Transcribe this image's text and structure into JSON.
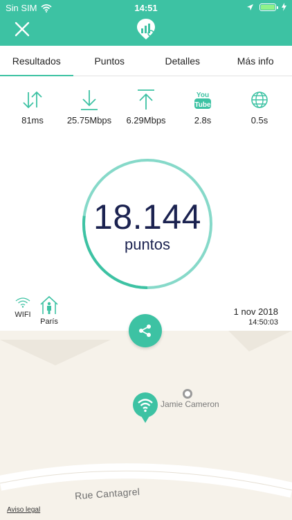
{
  "status_bar": {
    "carrier": "Sin SIM",
    "time": "14:51"
  },
  "tabs": [
    {
      "label": "Resultados"
    },
    {
      "label": "Puntos"
    },
    {
      "label": "Detalles"
    },
    {
      "label": "Más info"
    }
  ],
  "metrics": [
    {
      "icon": "ping-arrows-icon",
      "value": "81ms"
    },
    {
      "icon": "download-icon",
      "value": "25.75Mbps"
    },
    {
      "icon": "upload-icon",
      "value": "6.29Mbps"
    },
    {
      "icon": "youtube-icon",
      "value": "2.8s"
    },
    {
      "icon": "globe-icon",
      "value": "0.5s"
    }
  ],
  "score": {
    "value": "18.144",
    "label": "puntos",
    "ring_fill_fraction": 0.27
  },
  "connection": {
    "label": "WIFI",
    "icon": "wifi-icon"
  },
  "place": {
    "label": "París",
    "icon": "home-person-icon"
  },
  "timestamp": {
    "date": "1 nov 2018",
    "time": "14:50:03"
  },
  "map": {
    "poi_label": "Jamie Cameron",
    "street_label": "Rue Cantagrel",
    "legal_link": "Aviso legal"
  },
  "icons": {
    "close": "close-icon",
    "logo": "app-logo-icon",
    "share": "share-icon",
    "pin": "wifi-pin-icon"
  },
  "colors": {
    "accent": "#3dc2a3",
    "ring_light": "#86d9c9",
    "score_text": "#1b2250",
    "map_bg": "#f6f2ea"
  }
}
